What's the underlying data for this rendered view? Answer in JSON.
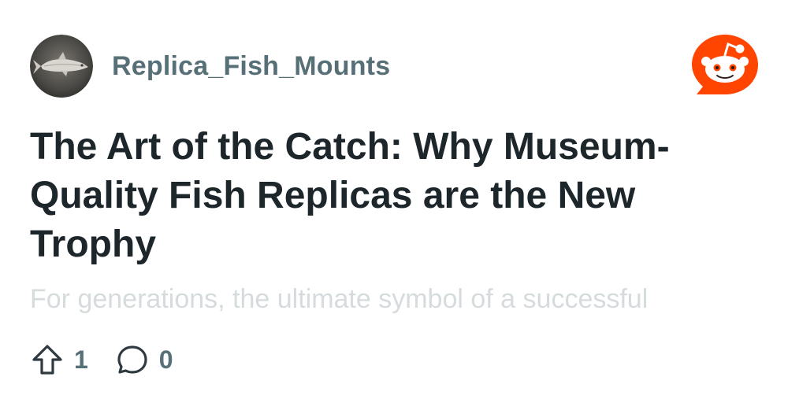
{
  "post": {
    "username": "Replica_Fish_Mounts",
    "title": "The Art of the Catch: Why Museum-Quality Fish Replicas are the New Trophy",
    "preview": "For generations, the ultimate symbol of a successful",
    "upvotes": "1",
    "comments": "0"
  },
  "icons": {
    "avatar": "fish-avatar-icon",
    "brand": "reddit-snoo-icon",
    "upvote": "upvote-arrow-icon",
    "comment": "comment-bubble-icon"
  },
  "colors": {
    "brand_orange": "#ff4500",
    "title": "#1c262b",
    "meta_gray": "#576f76",
    "preview_faded": "#d6dbde"
  }
}
